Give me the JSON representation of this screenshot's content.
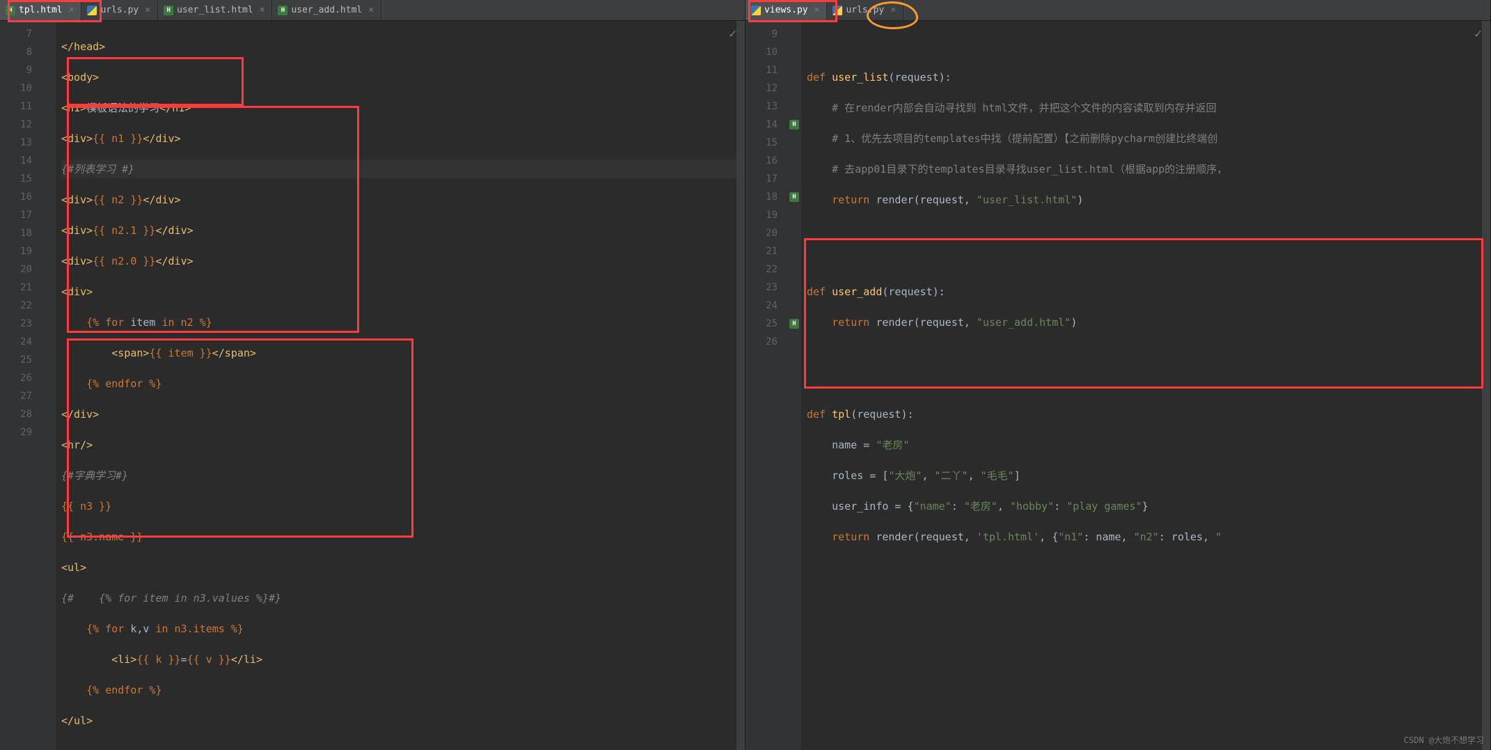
{
  "leftPane": {
    "tabs": [
      {
        "label": "tpl.html",
        "icon": "html",
        "active": true
      },
      {
        "label": "urls.py",
        "icon": "py",
        "active": false
      },
      {
        "label": "user_list.html",
        "icon": "html",
        "active": false
      },
      {
        "label": "user_add.html",
        "icon": "html",
        "active": false
      }
    ],
    "lineStart": 7,
    "lineEnd": 29,
    "code": {
      "l7": "</head>",
      "l8": "<body>",
      "l9_open": "<h1>",
      "l9_text": "模板语法的学习",
      "l9_close": "</h1>",
      "l10_a": "<div>",
      "l10_b": "{{ n1 }}",
      "l10_c": "</div>",
      "l11": "{#列表学习 #}",
      "l12_a": "<div>",
      "l12_b": "{{ n2 }}",
      "l12_c": "</div>",
      "l13_a": "<div>",
      "l13_b": "{{ n2.1 }}",
      "l13_c": "</div>",
      "l14_a": "<div>",
      "l14_b": "{{ n2.0 }}",
      "l14_c": "</div>",
      "l15": "<div>",
      "l16_a": "{% ",
      "l16_b": "for",
      "l16_c": " item ",
      "l16_d": "in",
      "l16_e": " n2 %}",
      "l17_a": "<span>",
      "l17_b": "{{ item }}",
      "l17_c": "</span>",
      "l18_a": "{% ",
      "l18_b": "endfor",
      "l18_c": " %}",
      "l19": "</div>",
      "l20": "<hr/>",
      "l21": "{#字典学习#}",
      "l22": "{{ n3 }}",
      "l23": "{{ n3.name }}",
      "l24": "<ul>",
      "l25_a": "{#",
      "l25_b": "    {% for item in n3.values %}#}",
      "l26_a": "{% ",
      "l26_b": "for",
      "l26_c": " k,v ",
      "l26_d": "in",
      "l26_e": " n3.items %}",
      "l27_a": "<li>",
      "l27_b": "{{ k }}",
      "l27_c": "=",
      "l27_d": "{{ v }}",
      "l27_e": "</li>",
      "l28_a": "{% ",
      "l28_b": "endfor",
      "l28_c": " %}",
      "l29": "</ul>"
    }
  },
  "rightPane": {
    "tabs": [
      {
        "label": "views.py",
        "icon": "py",
        "active": true
      },
      {
        "label": "urls.py",
        "icon": "py",
        "active": false
      }
    ],
    "lineStart": 9,
    "lineEnd": 26,
    "code": {
      "l9": "",
      "l10_a": "def ",
      "l10_b": "user_list",
      "l10_c": "(request):",
      "l11": "# 在render内部会自动寻找到 html文件，并把这个文件的内容读取到内存并返回",
      "l12": "# 1、优先去项目的templates中找（提前配置）【之前删除pycharm创建比终端创",
      "l13": "# 去app01目录下的templates目录寻找user_list.html（根据app的注册顺序，",
      "l14_a": "return ",
      "l14_b": "render(request, ",
      "l14_c": "\"user_list.html\"",
      "l14_d": ")",
      "l17_a": "def ",
      "l17_b": "user_add",
      "l17_c": "(request):",
      "l18_a": "return ",
      "l18_b": "render(request, ",
      "l18_c": "\"user_add.html\"",
      "l18_d": ")",
      "l21_a": "def ",
      "l21_b": "tpl",
      "l21_c": "(request):",
      "l22_a": "name = ",
      "l22_b": "\"老房\"",
      "l23_a": "roles = [",
      "l23_b": "\"大炮\"",
      "l23_c": ", ",
      "l23_d": "\"二丫\"",
      "l23_e": ", ",
      "l23_f": "\"毛毛\"",
      "l23_g": "]",
      "l24_a": "user_info = {",
      "l24_b": "\"name\"",
      "l24_c": ": ",
      "l24_d": "\"老房\"",
      "l24_e": ", ",
      "l24_f": "\"hobby\"",
      "l24_g": ": ",
      "l24_h": "\"play games\"",
      "l24_i": "}",
      "l25_a": "return ",
      "l25_b": "render(request, ",
      "l25_c": "'tpl.html'",
      "l25_d": ", {",
      "l25_e": "\"n1\"",
      "l25_f": ": name, ",
      "l25_g": "\"n2\"",
      "l25_h": ": roles, ",
      "l25_i": "\""
    }
  },
  "watermark": "CSDN @大炮不想学习"
}
